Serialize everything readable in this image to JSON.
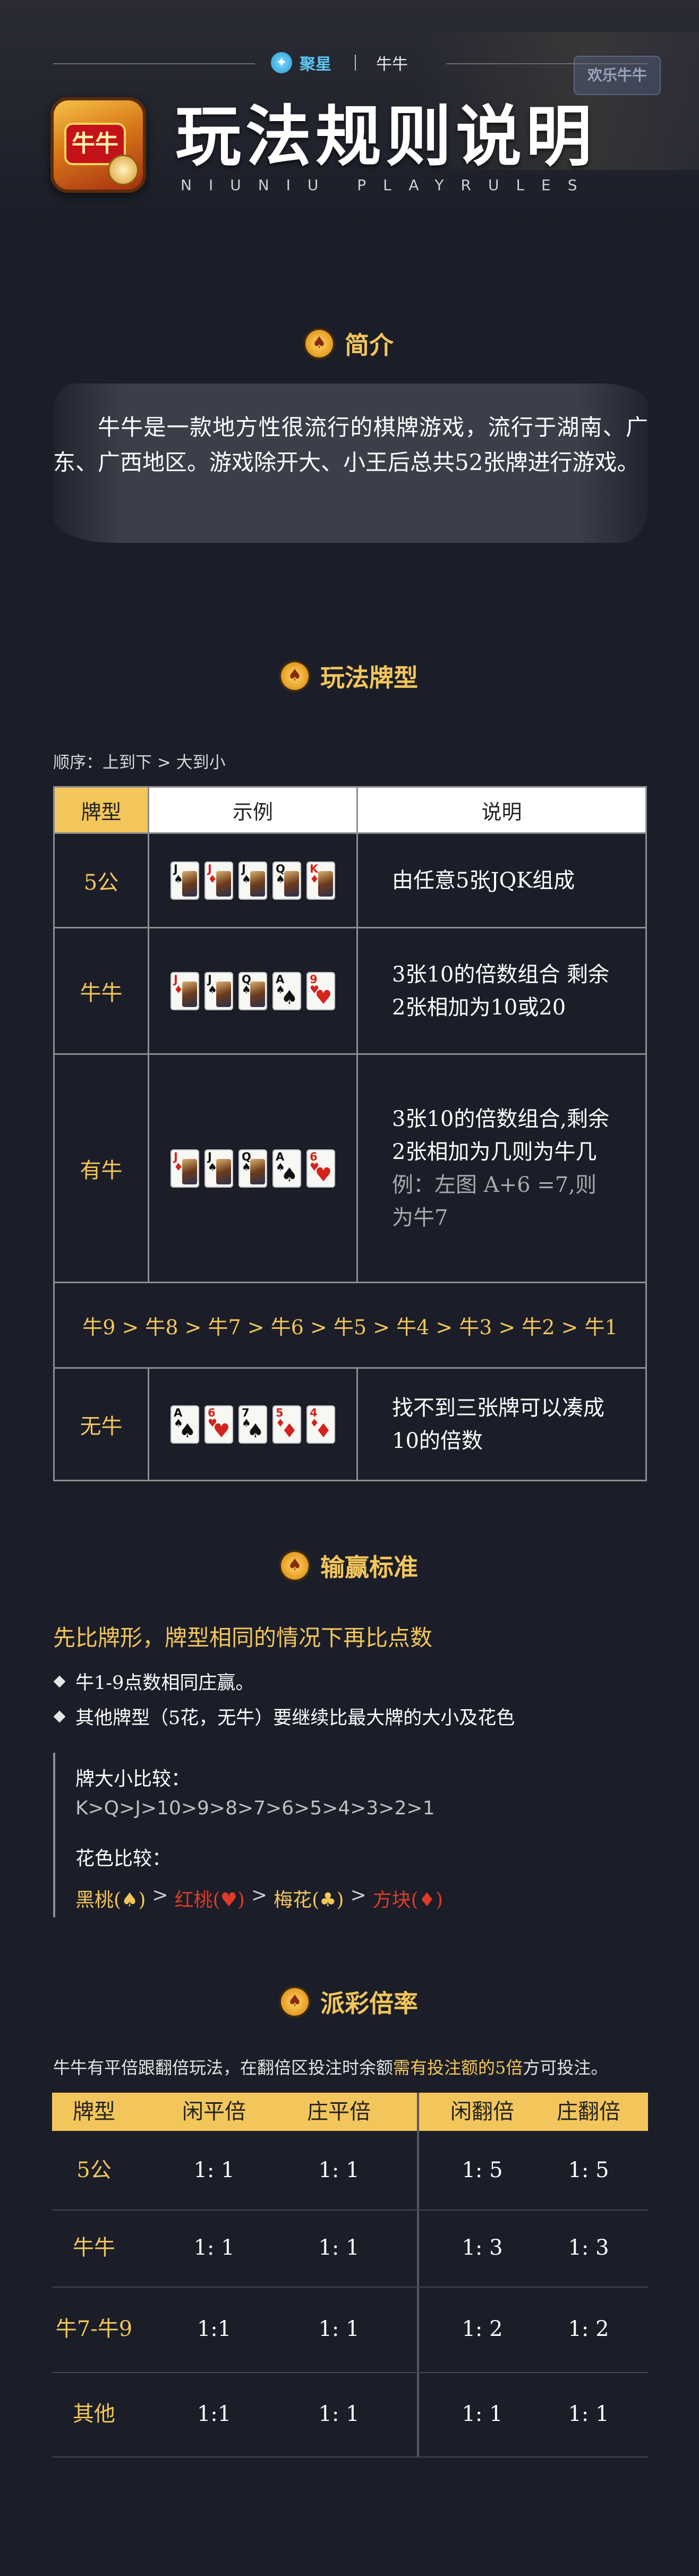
{
  "header": {
    "brand_name": "聚星",
    "game_name": "牛牛",
    "icon_badge": "牛牛",
    "title": "玩法规则说明",
    "subtitle": "NIUNIU PLAYRULES",
    "ghost_badge": "欢乐牛牛"
  },
  "intro": {
    "heading": "简介",
    "text": "牛牛是一款地方性很流行的棋牌游戏，流行于湖南、广东、广西地区。游戏除开大、小王后总共52张牌进行游戏。"
  },
  "types": {
    "heading": "玩法牌型",
    "order_note": "顺序：上到下 > 大到小",
    "col_type": "牌型",
    "col_example": "示例",
    "col_desc": "说明",
    "rows": [
      {
        "name": "5公",
        "desc": "由任意5张JQK组成",
        "cards": [
          {
            "rank": "J",
            "suit": "♠",
            "color": "blk",
            "face": true
          },
          {
            "rank": "J",
            "suit": "♦",
            "color": "red",
            "face": true
          },
          {
            "rank": "J",
            "suit": "♠",
            "color": "blk",
            "face": true
          },
          {
            "rank": "Q",
            "suit": "♠",
            "color": "blk",
            "face": true
          },
          {
            "rank": "K",
            "suit": "♦",
            "color": "red",
            "face": true
          }
        ]
      },
      {
        "name": "牛牛",
        "desc": "3张10的倍数组合 剩余2张相加为10或20",
        "cards": [
          {
            "rank": "J",
            "suit": "♦",
            "color": "red",
            "face": true
          },
          {
            "rank": "J",
            "suit": "♠",
            "color": "blk",
            "face": true
          },
          {
            "rank": "Q",
            "suit": "♠",
            "color": "blk",
            "face": true
          },
          {
            "rank": "A",
            "suit": "♠",
            "color": "blk",
            "face": false
          },
          {
            "rank": "9",
            "suit": "♥",
            "color": "red",
            "face": false
          }
        ]
      },
      {
        "name": "有牛",
        "desc": "3张10的倍数组合,剩余2张相加为几则为牛几",
        "example": "例：左图 A+6 =7,则为牛7",
        "cards": [
          {
            "rank": "J",
            "suit": "♦",
            "color": "red",
            "face": true
          },
          {
            "rank": "J",
            "suit": "♠",
            "color": "blk",
            "face": true
          },
          {
            "rank": "Q",
            "suit": "♠",
            "color": "blk",
            "face": true
          },
          {
            "rank": "A",
            "suit": "♠",
            "color": "blk",
            "face": false
          },
          {
            "rank": "6",
            "suit": "♥",
            "color": "red",
            "face": false
          }
        ]
      },
      {
        "name": "无牛",
        "desc": "找不到三张牌可以凑成10的倍数",
        "cards": [
          {
            "rank": "A",
            "suit": "♠",
            "color": "blk",
            "face": false
          },
          {
            "rank": "6",
            "suit": "♥",
            "color": "red",
            "face": false
          },
          {
            "rank": "7",
            "suit": "♠",
            "color": "blk",
            "face": false
          },
          {
            "rank": "5",
            "suit": "♦",
            "color": "red",
            "face": false
          },
          {
            "rank": "4",
            "suit": "♦",
            "color": "red",
            "face": false
          }
        ]
      }
    ],
    "sequence": "牛9 > 牛8 > 牛7 > 牛6 > 牛5 > 牛4 > 牛3 > 牛2 > 牛1"
  },
  "win": {
    "heading": "输赢标准",
    "lead": "先比牌形，牌型相同的情况下再比点数",
    "bullets": [
      "牛1-9点数相同庄赢。",
      "其他牌型（5花，无牛）要继续比最大牌的大小及花色"
    ],
    "size_label": "牌大小比较：",
    "size_value": "K>Q>J>10>9>8>7>6>5>4>3>2>1",
    "suit_label": "花色比较：",
    "suits": [
      "黑桃(♠)",
      "红桃(♥)",
      "梅花(♣)",
      "方块(♦)"
    ],
    "gt": ">"
  },
  "payout": {
    "heading": "派彩倍率",
    "note_pre": "牛牛有平倍跟翻倍玩法，在翻倍区投注时余额",
    "note_hl": "需有投注额的5倍",
    "note_post": "方可投注。",
    "headers": [
      "牌型",
      "闲平倍",
      "庄平倍",
      "闲翻倍",
      "庄翻倍"
    ],
    "rows": [
      [
        "5公",
        "1: 1",
        "1: 1",
        "1: 5",
        "1: 5"
      ],
      [
        "牛牛",
        "1: 1",
        "1: 1",
        "1: 3",
        "1: 3"
      ],
      [
        "牛7-牛9",
        "1:1",
        "1: 1",
        "1: 2",
        "1: 2"
      ],
      [
        "其他",
        "1:1",
        "1: 1",
        "1: 1",
        "1: 1"
      ]
    ]
  },
  "colors": {
    "gold": "#f3c65b",
    "background": "#1b1e28",
    "red": "#d4231c"
  }
}
